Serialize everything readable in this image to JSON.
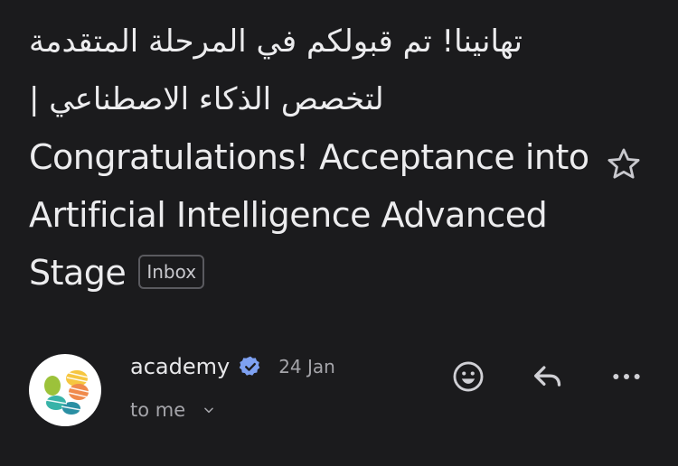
{
  "email": {
    "subject_arabic": "تهانينا! تم قبولكم في المرحلة المتقدمة لتخصص الذكاء الاصطناعي |",
    "subject_english": "Congratulations! Acceptance into Artificial Intelligence Advanced Stage",
    "label": "Inbox",
    "sender": {
      "name": "academy",
      "date": "24 Jan",
      "recipient": "to me"
    }
  },
  "icons": {
    "star": "star-outline-icon",
    "verified": "verified-badge-icon",
    "chevron": "chevron-down-icon",
    "emoji": "emoji-reaction-icon",
    "reply": "reply-icon",
    "more": "more-horizontal-icon"
  },
  "colors": {
    "background": "#1b1b1d",
    "text_primary": "#e8e8ea",
    "text_secondary": "#a5a5aa",
    "verified": "#7ea1f2"
  }
}
